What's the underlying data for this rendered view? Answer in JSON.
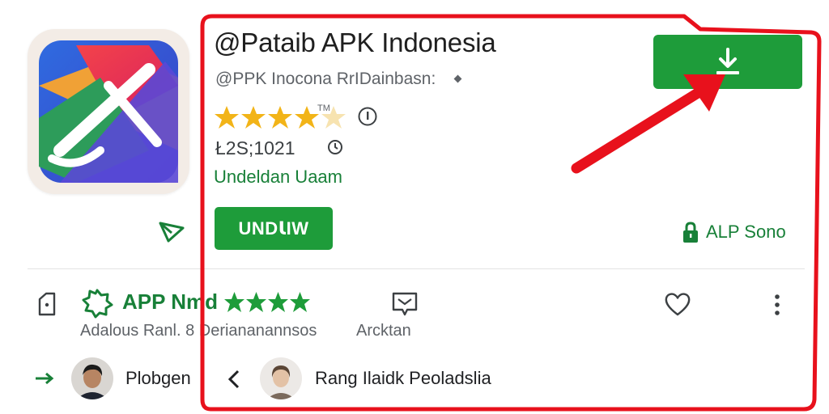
{
  "app": {
    "title": "@Pataib APK Indonesia",
    "developer": "@PPK Inocona RrIDainbasn:",
    "rating_stars": 4,
    "rating_sup": "TM",
    "downloads": "Ł2S;1021",
    "category": "Undeldan Uaam"
  },
  "actions": {
    "install_label": "UNDꙆIW",
    "download_icon": "download-icon",
    "security_label": "ALP Sono"
  },
  "highlights": {
    "award_title": "APP Nmd",
    "award_stars": 4,
    "award_desc": "Adalous Ranl. 8 Deriananannsos",
    "message_label": "Arcktan"
  },
  "reviews": [
    {
      "name": "Plobgen"
    },
    {
      "name": "Rang Ilaidk Peoladslia"
    }
  ],
  "colors": {
    "accent_green": "#1e9c3a",
    "star_gold": "#f2b418",
    "annotation_red": "#e8111c"
  }
}
